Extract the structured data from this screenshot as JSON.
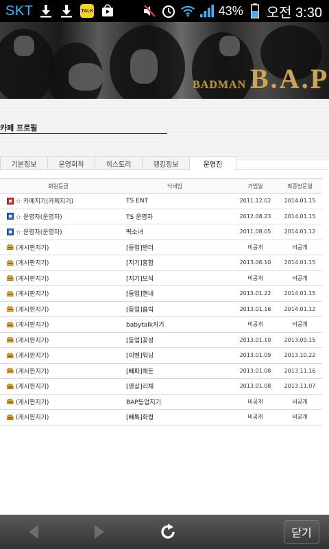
{
  "statusbar": {
    "carrier": "SKT",
    "icons": [
      "download-icon",
      "download-icon",
      "kakaotalk-icon",
      "play-store-icon",
      "mute-icon",
      "alarm-icon",
      "wifi-icon",
      "signal-icon",
      "battery-icon"
    ],
    "talk_label": "TALK",
    "battery_percent": "43%",
    "time": "오전 3:30"
  },
  "banner": {
    "brand_small": "BADMAN",
    "brand": "B.A.P"
  },
  "profile": {
    "title": "카페 프로필"
  },
  "tabs": [
    {
      "label": "기본정보",
      "active": false
    },
    {
      "label": "운영회칙",
      "active": false
    },
    {
      "label": "히스토리",
      "active": false
    },
    {
      "label": "랭킹정보",
      "active": false
    },
    {
      "label": "운영진",
      "active": true
    }
  ],
  "table": {
    "headers": {
      "grade": "회원등급",
      "nickname": "닉네임",
      "joined": "가입일",
      "last_visit": "최종방문일"
    },
    "rows": [
      {
        "icon": "manager-red-icon",
        "grade": "☆ 카페지기(카페지기)",
        "nickname": "TS ENT",
        "joined": "2011.12.02",
        "last": "2014.01.15"
      },
      {
        "icon": "staff-blue-icon",
        "grade": "☆ 운영자(운영자)",
        "nickname": "TS 운영자",
        "joined": "2012.08.23",
        "last": "2014.01.15"
      },
      {
        "icon": "staff-blue-icon",
        "grade": "☆ 운영자(운영자)",
        "nickname": "떡소녀",
        "joined": "2011.08.05",
        "last": "2014.01.12"
      },
      {
        "icon": "board-keeper-icon",
        "grade": "(게시판지기)",
        "nickname": "[등업]텐더",
        "joined": "비공개",
        "last": "비공개"
      },
      {
        "icon": "board-keeper-icon",
        "grade": "(게시판지기)",
        "nickname": "[지기]홍합",
        "joined": "2013.06.10",
        "last": "2014.01.15"
      },
      {
        "icon": "board-keeper-icon",
        "grade": "(게시판지기)",
        "nickname": "[지기]보석",
        "joined": "비공개",
        "last": "비공개"
      },
      {
        "icon": "board-keeper-icon",
        "grade": "(게시판지기)",
        "nickname": "[등업]핸내",
        "joined": "2013.01.22",
        "last": "2014.01.15"
      },
      {
        "icon": "board-keeper-icon",
        "grade": "(게시판지기)",
        "nickname": "[등업]흡릭",
        "joined": "2013.01.16",
        "last": "2014.01.12"
      },
      {
        "icon": "board-keeper-icon",
        "grade": "(게시판지기)",
        "nickname": "babytalk지기",
        "joined": "비공개",
        "last": "비공개"
      },
      {
        "icon": "board-keeper-icon",
        "grade": "(게시판지기)",
        "nickname": "[등업]꽃성",
        "joined": "2013.01.10",
        "last": "2013.09.15"
      },
      {
        "icon": "board-keeper-icon",
        "grade": "(게시판지기)",
        "nickname": "[이벤]워닝",
        "joined": "2013.01.09",
        "last": "2013.10.22"
      },
      {
        "icon": "board-keeper-icon",
        "grade": "(게시판지기)",
        "nickname": "[빼파]해든",
        "joined": "2013.01.08",
        "last": "2013.11.16"
      },
      {
        "icon": "board-keeper-icon",
        "grade": "(게시판지기)",
        "nickname": "[영상]리채",
        "joined": "2013.01.08",
        "last": "2013.11.07"
      },
      {
        "icon": "board-keeper-icon",
        "grade": "(게시판지기)",
        "nickname": "BAP등업지기",
        "joined": "비공개",
        "last": "비공개"
      },
      {
        "icon": "board-keeper-icon",
        "grade": "(게시판지기)",
        "nickname": "[빼톡]화령",
        "joined": "비공개",
        "last": "비공개"
      }
    ]
  },
  "bottombar": {
    "icons": [
      "back-arrow-icon",
      "forward-arrow-icon",
      "refresh-icon"
    ],
    "close_label": "닫기"
  },
  "colors": {
    "carrier": "#37b6ff",
    "brand": "#c9a55b",
    "bottombar": "#3a3a3a"
  }
}
